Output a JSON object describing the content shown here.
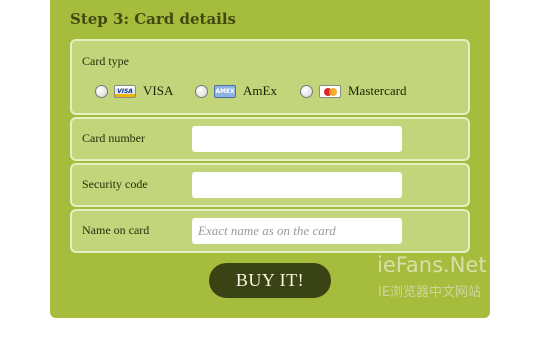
{
  "step": {
    "title": "Step 3: Card details"
  },
  "card_type": {
    "label": "Card type",
    "options": [
      {
        "label": "VISA",
        "icon": "visa-card-icon",
        "icon_text": "VISA"
      },
      {
        "label": "AmEx",
        "icon": "amex-card-icon",
        "icon_text": "AMEX"
      },
      {
        "label": "Mastercard",
        "icon": "mastercard-icon"
      }
    ]
  },
  "fields": {
    "card_number": {
      "label": "Card number",
      "value": ""
    },
    "security_code": {
      "label": "Security code",
      "value": ""
    },
    "name_on_card": {
      "label": "Name on card",
      "value": "",
      "placeholder": "Exact name as on the card"
    }
  },
  "buy_button": {
    "label": "BUY IT!"
  },
  "watermark": {
    "title": "ieFans.Net",
    "subtitle": "IE浏览器中文网站"
  },
  "colors": {
    "panel": "#a6bc3c",
    "box": "#c2d57a",
    "button": "#3a4313"
  }
}
